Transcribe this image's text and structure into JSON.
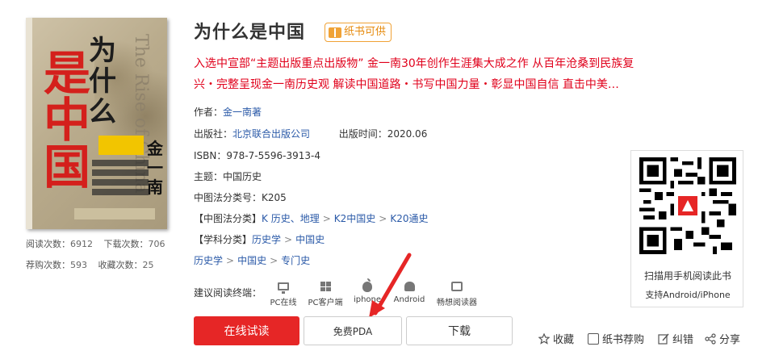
{
  "book": {
    "title": "为什么是中国",
    "badge": "纸书可供",
    "description": "入选中宣部“主题出版重点出版物” 金一南30年创作生涯集大成之作 从百年沧桑到民族复兴・完整呈现金一南历史观 解读中国道路・书写中国力量・彰显中国自信 直击中美…",
    "author_label": "作者：",
    "author": "金一南著",
    "publisher_label": "出版社：",
    "publisher": "北京联合出版公司",
    "pubdate_label": "出版时间：",
    "pubdate": "2020.06",
    "isbn_label": "ISBN：",
    "isbn": "978-7-5596-3913-4",
    "subject_label": "主题：",
    "subject": "中国历史",
    "clc_label": "中图法分类号：",
    "clc": "K205",
    "clc_cat_label": "【中图法分类】",
    "clc_cat": [
      "K 历史、地理",
      "K2中国史",
      "K20通史"
    ],
    "subject_cat_label": "【学科分类】",
    "subject_cat": [
      "历史学",
      "中国史"
    ],
    "subject_path": [
      "历史学",
      "中国史",
      "专门史"
    ]
  },
  "cover": {
    "title_black": "为什么",
    "title_red": "是中国",
    "author_mark": "金一南",
    "english": "The Rise of China"
  },
  "stats": {
    "read_label": "阅读次数：",
    "read": "6912",
    "download_label": "下载次数：",
    "download": "706",
    "recommend_label": "荐购次数：",
    "recommend": "593",
    "favorite_label": "收藏次数：",
    "favorite": "25"
  },
  "reading": {
    "label": "建议阅读终端：",
    "terminals": [
      {
        "label": "PC在线",
        "icon": "monitor-icon"
      },
      {
        "label": "PC客户端",
        "icon": "windows-icon"
      },
      {
        "label": "iphone",
        "icon": "apple-icon"
      },
      {
        "label": "Android",
        "icon": "android-icon"
      },
      {
        "label": "畅想阅读器",
        "icon": "reader-icon"
      }
    ]
  },
  "buttons": {
    "read_online": "在线试读",
    "free_pda": "免费PDA",
    "download": "下载"
  },
  "actions": {
    "favorite": "收藏",
    "recommend": "纸书荐购",
    "correct": "纠错",
    "share": "分享"
  },
  "qr": {
    "caption1": "扫描用手机阅读此书",
    "caption2": "支持Android/iPhone"
  },
  "colors": {
    "accent_red": "#e62626",
    "link_blue": "#2b5aa8",
    "badge_orange": "#f0a235",
    "desc_red": "#e0001b"
  }
}
